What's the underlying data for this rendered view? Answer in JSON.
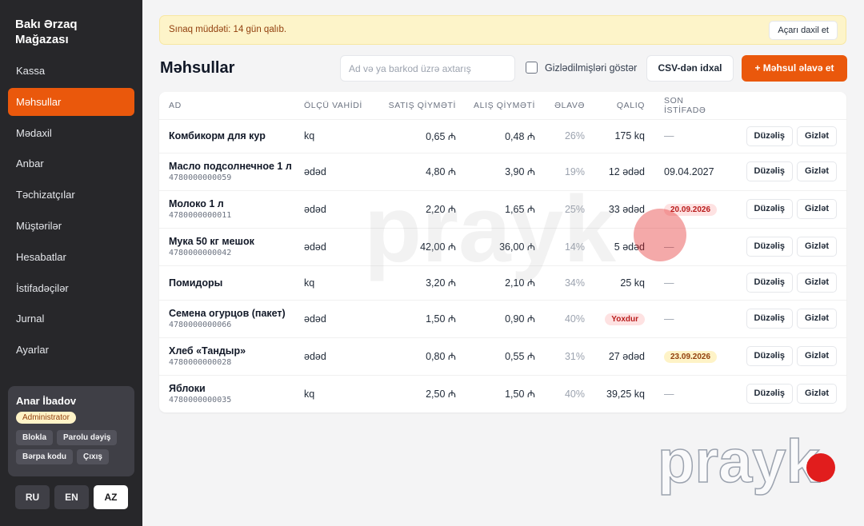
{
  "sidebar": {
    "brand": "Bakı Ərzaq Mağazası",
    "items": [
      {
        "label": "Kassa"
      },
      {
        "label": "Məhsullar"
      },
      {
        "label": "Mədaxil"
      },
      {
        "label": "Anbar"
      },
      {
        "label": "Təchizatçılar"
      },
      {
        "label": "Müştərilər"
      },
      {
        "label": "Hesabatlar"
      },
      {
        "label": "İstifadəçilər"
      },
      {
        "label": "Jurnal"
      },
      {
        "label": "Ayarlar"
      }
    ],
    "active_index": 1,
    "user": {
      "name": "Anar İbadov",
      "role": "Administrator",
      "actions": [
        "Blokla",
        "Parolu dəyiş",
        "Bərpa kodu",
        "Çıxış"
      ]
    },
    "languages": [
      "RU",
      "EN",
      "AZ"
    ],
    "active_language": "AZ"
  },
  "banner": {
    "text": "Sınaq müddəti: 14 gün qalıb.",
    "button": "Açarı daxil et"
  },
  "page": {
    "title": "Məhsullar",
    "search_placeholder": "Ad və ya barkod üzrə axtarış",
    "show_hidden_label": "Gizlədilmişləri göstər",
    "show_hidden_checked": false,
    "csv_button": "CSV-dən idxal",
    "add_button": "+ Məhsul əlavə et"
  },
  "table": {
    "columns": [
      "AD",
      "ÖLÇÜ VAHİDİ",
      "SATIŞ QİYMƏTİ",
      "ALIŞ QİYMƏTİ",
      "ƏLAVƏ",
      "QALIQ",
      "SON İSTİFADƏ"
    ],
    "edit_label": "Düzəliş",
    "hide_label": "Gizlət",
    "rows": [
      {
        "name": "Комбикорм для кур",
        "code": "",
        "unit": "kq",
        "sale": "0,65 ₼",
        "purchase": "0,48 ₼",
        "markup": "26%",
        "stock": "175 kq",
        "stock_badge": "",
        "expiry": "—",
        "expiry_badge": ""
      },
      {
        "name": "Масло подсолнечное 1 л",
        "code": "4780000000059",
        "unit": "ədəd",
        "sale": "4,80 ₼",
        "purchase": "3,90 ₼",
        "markup": "19%",
        "stock": "12 ədəd",
        "stock_badge": "",
        "expiry": "09.04.2027",
        "expiry_badge": ""
      },
      {
        "name": "Молоко 1 л",
        "code": "4780000000011",
        "unit": "ədəd",
        "sale": "2,20 ₼",
        "purchase": "1,65 ₼",
        "markup": "25%",
        "stock": "33 ədəd",
        "stock_badge": "",
        "expiry": "20.09.2026",
        "expiry_badge": "red"
      },
      {
        "name": "Мука 50 кг мешок",
        "code": "4780000000042",
        "unit": "ədəd",
        "sale": "42,00 ₼",
        "purchase": "36,00 ₼",
        "markup": "14%",
        "stock": "5 ədəd",
        "stock_badge": "",
        "expiry": "—",
        "expiry_badge": ""
      },
      {
        "name": "Помидоры",
        "code": "",
        "unit": "kq",
        "sale": "3,20 ₼",
        "purchase": "2,10 ₼",
        "markup": "34%",
        "stock": "25 kq",
        "stock_badge": "",
        "expiry": "—",
        "expiry_badge": ""
      },
      {
        "name": "Семена огурцов (пакет)",
        "code": "4780000000066",
        "unit": "ədəd",
        "sale": "1,50 ₼",
        "purchase": "0,90 ₼",
        "markup": "40%",
        "stock": "Yoxdur",
        "stock_badge": "red",
        "expiry": "—",
        "expiry_badge": ""
      },
      {
        "name": "Хлеб «Тандыр»",
        "code": "4780000000028",
        "unit": "ədəd",
        "sale": "0,80 ₼",
        "purchase": "0,55 ₼",
        "markup": "31%",
        "stock": "27 ədəd",
        "stock_badge": "",
        "expiry": "23.09.2026",
        "expiry_badge": "yellow"
      },
      {
        "name": "Яблоки",
        "code": "4780000000035",
        "unit": "kq",
        "sale": "2,50 ₼",
        "purchase": "1,50 ₼",
        "markup": "40%",
        "stock": "39,25 kq",
        "stock_badge": "",
        "expiry": "—",
        "expiry_badge": ""
      }
    ]
  },
  "watermark": {
    "text": "prayk"
  },
  "colors": {
    "accent": "#ea580c",
    "sidebar": "#27272a",
    "banner": "#fdf4c9",
    "watermark_dot": "#e11d1d"
  }
}
